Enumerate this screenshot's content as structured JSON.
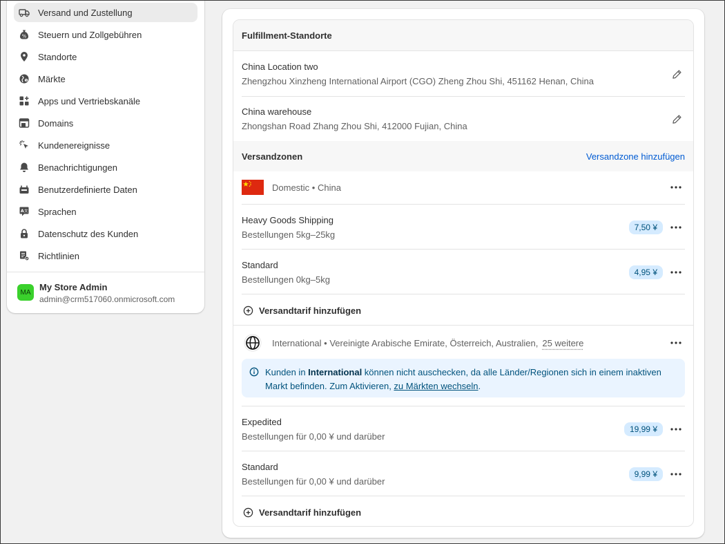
{
  "sidebar": {
    "items": [
      {
        "label": "Versand und Zustellung",
        "icon": "truck-icon",
        "active": true
      },
      {
        "label": "Steuern und Zollgebühren",
        "icon": "money-bag-icon"
      },
      {
        "label": "Standorte",
        "icon": "location-pin-icon"
      },
      {
        "label": "Märkte",
        "icon": "globe-market-icon"
      },
      {
        "label": "Apps und Vertriebskanäle",
        "icon": "apps-icon"
      },
      {
        "label": "Domains",
        "icon": "domain-icon"
      },
      {
        "label": "Kundenereignisse",
        "icon": "cursor-click-icon"
      },
      {
        "label": "Benachrichtigungen",
        "icon": "bell-icon"
      },
      {
        "label": "Benutzerdefinierte Daten",
        "icon": "database-icon"
      },
      {
        "label": "Sprachen",
        "icon": "translate-icon"
      },
      {
        "label": "Datenschutz des Kunden",
        "icon": "lock-icon"
      },
      {
        "label": "Richtlinien",
        "icon": "policy-icon"
      }
    ],
    "user": {
      "initials": "MA",
      "name": "My Store Admin",
      "email": "admin@crm517060.onmicrosoft.com"
    }
  },
  "fulfillment": {
    "title": "Fulfillment-Standorte",
    "locations": [
      {
        "name": "China Location two",
        "address": "Zhengzhou Xinzheng International Airport (CGO) Zheng Zhou Shi, 451162 Henan, China"
      },
      {
        "name": "China warehouse",
        "address": "Zhongshan Road Zhang Zhou Shi, 412000 Fujian, China"
      }
    ]
  },
  "zones": {
    "title": "Versandzonen",
    "add_link": "Versandzone hinzufügen",
    "domestic": {
      "label": "Domestic • China",
      "rates": [
        {
          "name": "Heavy Goods Shipping",
          "condition": "Bestellungen 5kg–25kg",
          "price": "7,50 ¥"
        },
        {
          "name": "Standard",
          "condition": "Bestellungen 0kg–5kg",
          "price": "4,95 ¥"
        }
      ],
      "add_rate": "Versandtarif hinzufügen"
    },
    "international": {
      "label": "International • Vereinigte Arabische Emirate, Österreich, Australien,",
      "more": "25 weitere",
      "banner": {
        "pre": "Kunden in ",
        "bold": "International",
        "mid": " können nicht auschecken, da alle Länder/Regionen sich in einem inaktiven Markt befinden. Zum Aktivieren, ",
        "link": "zu Märkten wechseln",
        "post": "."
      },
      "rates": [
        {
          "name": "Expedited",
          "condition": "Bestellungen für 0,00 ¥ und darüber",
          "price": "19,99 ¥"
        },
        {
          "name": "Standard",
          "condition": "Bestellungen für 0,00 ¥ und darüber",
          "price": "9,99 ¥"
        }
      ],
      "add_rate": "Versandtarif hinzufügen"
    }
  },
  "colors": {
    "accent_link": "#005bd3",
    "badge_bg": "#d5ebff",
    "banner_bg": "#eaf4ff",
    "avatar_bg": "#3ad12c",
    "china_flag_red": "#de2910",
    "china_flag_yellow": "#ffde00"
  }
}
